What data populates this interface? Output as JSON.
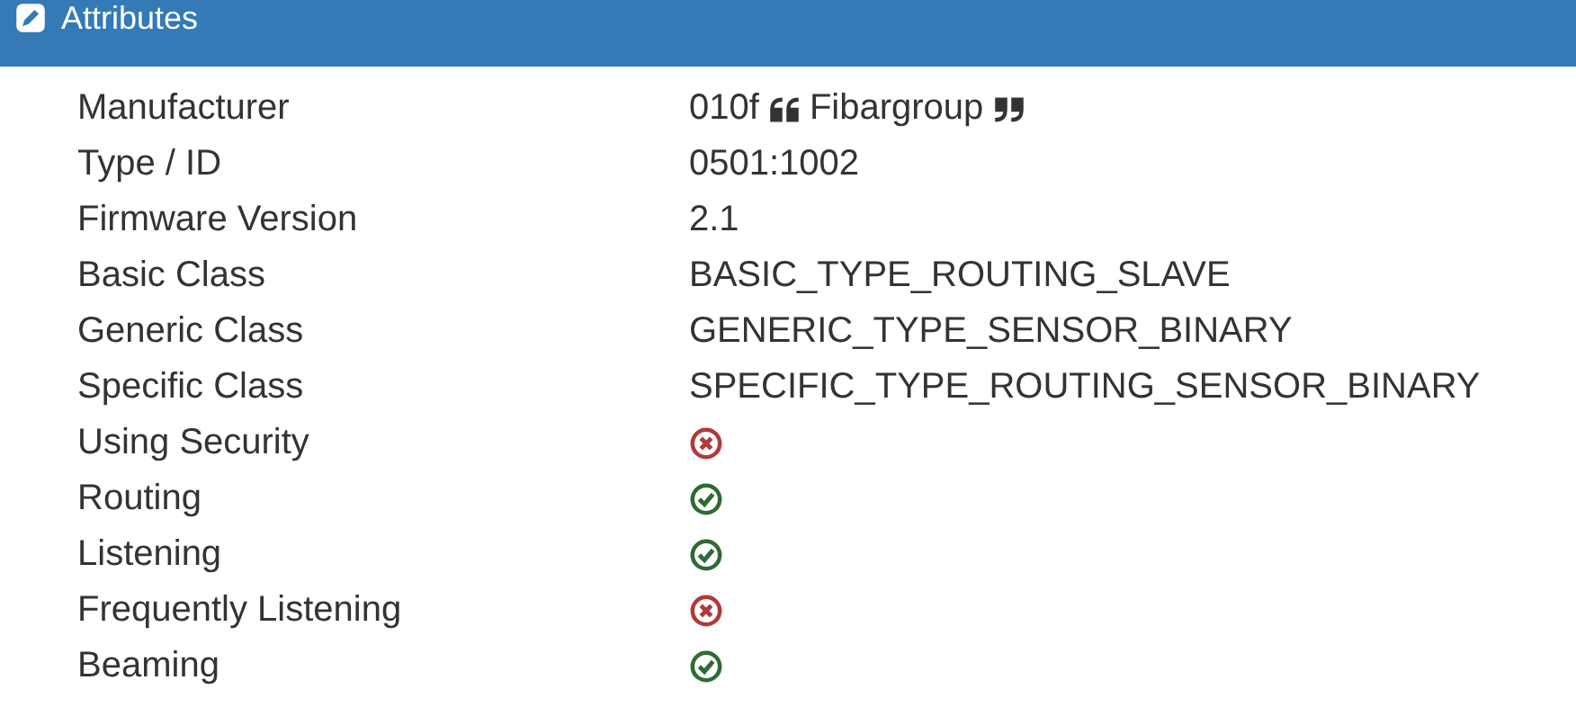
{
  "panel": {
    "title": "Attributes"
  },
  "rows": [
    {
      "label": "Manufacturer",
      "kind": "manufacturer",
      "code": "010f",
      "name": "Fibargroup"
    },
    {
      "label": "Type / ID",
      "kind": "text",
      "value": "0501:1002"
    },
    {
      "label": "Firmware Version",
      "kind": "text",
      "value": "2.1"
    },
    {
      "label": "Basic Class",
      "kind": "text",
      "value": "BASIC_TYPE_ROUTING_SLAVE"
    },
    {
      "label": "Generic Class",
      "kind": "text",
      "value": "GENERIC_TYPE_SENSOR_BINARY"
    },
    {
      "label": "Specific Class",
      "kind": "text",
      "value": "SPECIFIC_TYPE_ROUTING_SENSOR_BINARY"
    },
    {
      "label": "Using Security",
      "kind": "flag",
      "on": false
    },
    {
      "label": "Routing",
      "kind": "flag",
      "on": true
    },
    {
      "label": "Listening",
      "kind": "flag",
      "on": true
    },
    {
      "label": "Frequently Listening",
      "kind": "flag",
      "on": false
    },
    {
      "label": "Beaming",
      "kind": "flag",
      "on": true
    }
  ]
}
